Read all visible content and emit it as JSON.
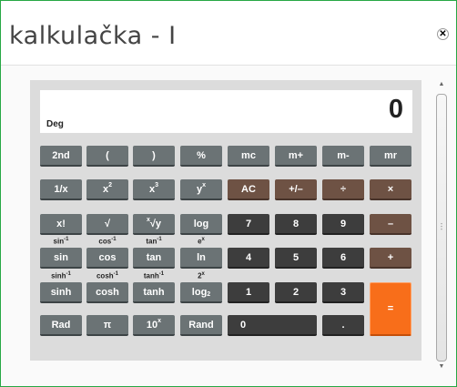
{
  "window": {
    "title": "kalkulačka - I",
    "close_icon": "close-icon"
  },
  "display": {
    "mode": "Deg",
    "value": "0"
  },
  "keys": {
    "k2nd": "2nd",
    "lparen": "(",
    "rparen": ")",
    "percent": "%",
    "mc": "mc",
    "mplus": "m+",
    "mminus": "m-",
    "mr": "mr",
    "inv": "1/x",
    "sq_base": "x",
    "sq_exp": "2",
    "cube_base": "x",
    "cube_exp": "3",
    "pow_base": "y",
    "pow_exp": "x",
    "ac": "AC",
    "sign": "+/–",
    "div": "÷",
    "mul": "×",
    "fact": "x!",
    "sqrt": "√",
    "root_index": "x",
    "root_body": "√y",
    "log": "log",
    "n7": "7",
    "n8": "8",
    "n9": "9",
    "minus": "–",
    "sin": "sin",
    "cos": "cos",
    "tan": "tan",
    "ln": "ln",
    "n4": "4",
    "n5": "5",
    "n6": "6",
    "plus": "+",
    "sinh": "sinh",
    "cosh": "cosh",
    "tanh": "tanh",
    "log2_base": "log",
    "log2_sub": "2",
    "n1": "1",
    "n2": "2",
    "n3": "3",
    "equals": "=",
    "rad": "Rad",
    "pi": "π",
    "ten_base": "10",
    "ten_exp": "x",
    "rand": "Rand",
    "n0": "0",
    "dot": "."
  },
  "second_labels": {
    "asin_base": "sin",
    "asin_exp": "-1",
    "acos_base": "cos",
    "acos_exp": "-1",
    "atan_base": "tan",
    "atan_exp": "-1",
    "exp_base": "e",
    "exp_exp": "x",
    "asinh_base": "sinh",
    "asinh_exp": "-1",
    "acosh_base": "cosh",
    "acosh_exp": "-1",
    "atanh_base": "tanh",
    "atanh_exp": "-1",
    "twox_base": "2",
    "twox_exp": "x"
  },
  "colors": {
    "accent_border": "#27a844",
    "equals": "#f86e1a",
    "gray_key": "#6b7375",
    "dark_key": "#3d3d3d",
    "brown_key": "#6e5244"
  }
}
